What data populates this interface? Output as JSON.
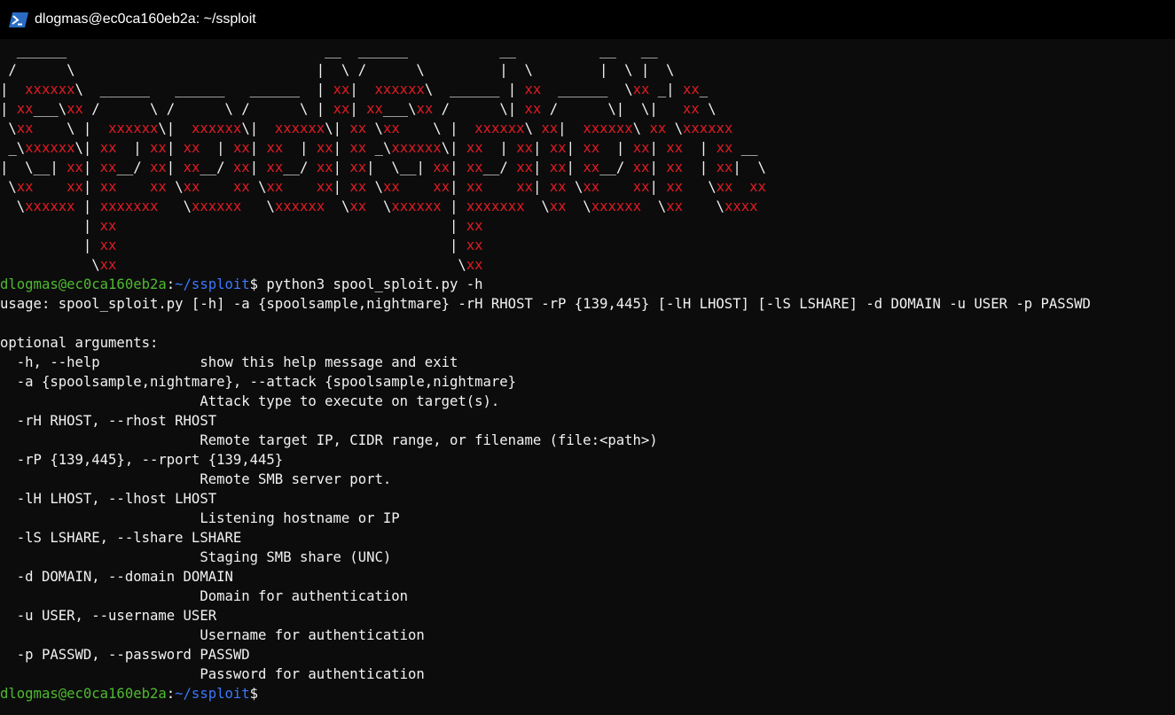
{
  "window": {
    "title": "dlogmas@ec0ca160eb2a: ~/ssploit",
    "icon": "powershell-icon"
  },
  "colors": {
    "background": "#0c0c0c",
    "foreground": "#cccccc",
    "banner_red": "#e01b24",
    "prompt_green": "#4eba2f",
    "path_blue": "#3b78ff"
  },
  "banner": [
    "  ______                               __  ______           __          __   __",
    " /      \\                             |  \\ /      \\         |  \\        |  \\ |  \\",
    "|  xxxxxx\\  ______   ______   ______  | xx|  xxxxxx\\  ______ | xx  ______  \\xx _| xx_",
    "| xx___\\xx /      \\ /      \\ /      \\ | xx| xx___\\xx /      \\| xx /      \\|  \\|   xx \\",
    " \\xx    \\ |  xxxxxx\\|  xxxxxx\\|  xxxxxx\\| xx \\xx    \\ |  xxxxxx\\ xx|  xxxxxx\\ xx \\xxxxxx",
    " _\\xxxxxx\\| xx  | xx| xx  | xx| xx  | xx| xx _\\xxxxxx\\| xx  | xx| xx| xx  | xx| xx  | xx __",
    "|  \\__| xx| xx__/ xx| xx__/ xx| xx__/ xx| xx|  \\__| xx| xx__/ xx| xx| xx__/ xx| xx  | xx|  \\",
    " \\xx    xx| xx    xx \\xx    xx \\xx    xx| xx \\xx    xx| xx    xx| xx \\xx    xx| xx   \\xx  xx",
    "  \\xxxxxx | xxxxxxx   \\xxxxxx   \\xxxxxx  \\xx  \\xxxxxx | xxxxxxx  \\xx  \\xxxxxx  \\xx    \\xxxx",
    "          | xx                                        | xx",
    "          | xx                                        | xx",
    "           \\xx                                         \\xx"
  ],
  "prompt": {
    "user_host": "dlogmas@ec0ca160eb2a",
    "separator": ":",
    "path": "~/ssploit",
    "symbol": "$"
  },
  "command": " python3 spool_sploit.py -h",
  "help_output": [
    "usage: spool_sploit.py [-h] -a {spoolsample,nightmare} -rH RHOST -rP {139,445} [-lH LHOST] [-lS LSHARE] -d DOMAIN -u USER -p PASSWD",
    "",
    "optional arguments:",
    "  -h, --help            show this help message and exit",
    "  -a {spoolsample,nightmare}, --attack {spoolsample,nightmare}",
    "                        Attack type to execute on target(s).",
    "  -rH RHOST, --rhost RHOST",
    "                        Remote target IP, CIDR range, or filename (file:<path>)",
    "  -rP {139,445}, --rport {139,445}",
    "                        Remote SMB server port.",
    "  -lH LHOST, --lhost LHOST",
    "                        Listening hostname or IP",
    "  -lS LSHARE, --lshare LSHARE",
    "                        Staging SMB share (UNC)",
    "  -d DOMAIN, --domain DOMAIN",
    "                        Domain for authentication",
    "  -u USER, --username USER",
    "                        Username for authentication",
    "  -p PASSWD, --password PASSWD",
    "                        Password for authentication"
  ]
}
